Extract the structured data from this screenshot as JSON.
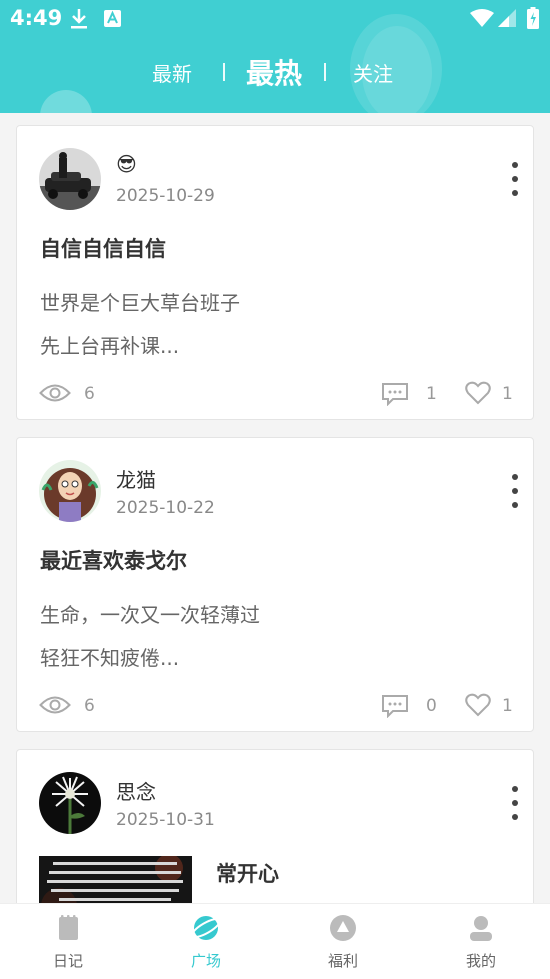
{
  "status_bar": {
    "time": "4:49"
  },
  "top_tabs": [
    {
      "label": "最新",
      "active": false
    },
    {
      "label": "最热",
      "active": true
    },
    {
      "label": "关注",
      "active": false
    }
  ],
  "posts": [
    {
      "author": "😎",
      "date": "2025-10-29",
      "title": "自信自信自信",
      "lines": [
        "世界是个巨大草台班子",
        "先上台再补课..."
      ],
      "views": "6",
      "comments": "1",
      "likes": "1"
    },
    {
      "author": "龙猫",
      "date": "2025-10-22",
      "title": "最近喜欢泰戈尔",
      "lines": [
        "生命，一次又一次轻薄过",
        "轻狂不知疲倦..."
      ],
      "views": "6",
      "comments": "0",
      "likes": "1"
    },
    {
      "author": "思念",
      "date": "2025-10-31",
      "title": "常开心"
    }
  ],
  "bottom_nav": [
    {
      "label": "日记",
      "icon": "diary-icon",
      "active": false
    },
    {
      "label": "广场",
      "icon": "square-icon",
      "active": true
    },
    {
      "label": "福利",
      "icon": "welfare-icon",
      "active": false
    },
    {
      "label": "我的",
      "icon": "profile-icon",
      "active": false
    }
  ],
  "colors": {
    "accent": "#40cfd2",
    "nav_active": "#36c9cf"
  }
}
